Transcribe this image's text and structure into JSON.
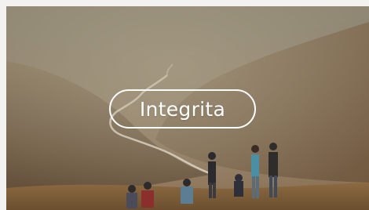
{
  "hero": {
    "button_label": "Integrita",
    "image_alt": "mountain-valley-hikers-photo"
  },
  "colors": {
    "page_background": "#f3f2f1",
    "label_text": "#ffffff",
    "pill_border": "#ffffff"
  }
}
